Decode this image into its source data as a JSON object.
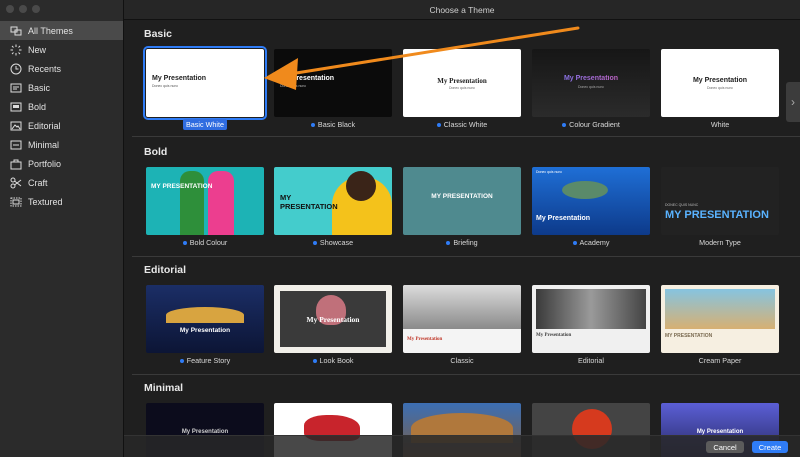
{
  "window": {
    "title": "Choose a Theme"
  },
  "sidebar": {
    "items": [
      {
        "label": "All Themes",
        "icon": "all-themes-icon"
      },
      {
        "label": "New",
        "icon": "new-sparkle-icon"
      },
      {
        "label": "Recents",
        "icon": "clock-icon"
      },
      {
        "label": "Basic",
        "icon": "basic-slide-icon"
      },
      {
        "label": "Bold",
        "icon": "bold-slide-icon"
      },
      {
        "label": "Editorial",
        "icon": "editorial-icon"
      },
      {
        "label": "Minimal",
        "icon": "minimal-icon"
      },
      {
        "label": "Portfolio",
        "icon": "portfolio-icon"
      },
      {
        "label": "Craft",
        "icon": "craft-scissors-icon"
      },
      {
        "label": "Textured",
        "icon": "textured-icon"
      }
    ]
  },
  "sections": {
    "basic": {
      "title": "Basic",
      "themes": [
        {
          "label": "Basic White",
          "thumb_title": "My Presentation",
          "thumb_sub": "Donec quis nunc",
          "has_dot": false,
          "selected": true
        },
        {
          "label": "Basic Black",
          "thumb_title": "My Presentation",
          "thumb_sub": "Donec quis nunc",
          "has_dot": true
        },
        {
          "label": "Classic White",
          "thumb_title": "My Presentation",
          "thumb_sub": "Donec quis nunc",
          "has_dot": true
        },
        {
          "label": "Colour Gradient",
          "thumb_title": "My Presentation",
          "thumb_sub": "Donec quis nunc",
          "has_dot": true
        },
        {
          "label": "White",
          "thumb_title": "My Presentation",
          "thumb_sub": "Donec quis nunc",
          "has_dot": false
        }
      ]
    },
    "bold": {
      "title": "Bold",
      "themes": [
        {
          "label": "Bold Colour",
          "thumb_title": "MY PRESENTATION",
          "has_dot": true
        },
        {
          "label": "Showcase",
          "thumb_title": "MY PRESENTATION",
          "has_dot": true
        },
        {
          "label": "Briefing",
          "thumb_title": "MY PRESENTATION",
          "has_dot": true
        },
        {
          "label": "Academy",
          "thumb_title": "My Presentation",
          "thumb_sub": "Donec quis nunc",
          "has_dot": true
        },
        {
          "label": "Modern Type",
          "thumb_title": "MY PRESENTATION",
          "thumb_sub": "DONEC QUIS NUNC",
          "has_dot": false
        }
      ]
    },
    "editorial": {
      "title": "Editorial",
      "themes": [
        {
          "label": "Feature Story",
          "thumb_title": "My Presentation",
          "has_dot": true
        },
        {
          "label": "Look Book",
          "thumb_title": "My Presentation",
          "has_dot": true
        },
        {
          "label": "Classic",
          "thumb_title": "My Presentation",
          "has_dot": false
        },
        {
          "label": "Editorial",
          "thumb_title": "My Presentation",
          "has_dot": false
        },
        {
          "label": "Cream Paper",
          "thumb_title": "MY PRESENTATION",
          "has_dot": false
        }
      ]
    },
    "minimal": {
      "title": "Minimal",
      "themes": [
        {
          "thumb_title": "My Presentation"
        },
        {
          "thumb_title": ""
        },
        {
          "thumb_title": ""
        },
        {
          "thumb_title": ""
        },
        {
          "thumb_title": "My Presentation"
        }
      ]
    }
  },
  "buttons": {
    "cancel": "Cancel",
    "create": "Create"
  },
  "colors": {
    "accent": "#2f7cf6",
    "annotation_arrow": "#f08a1c"
  }
}
